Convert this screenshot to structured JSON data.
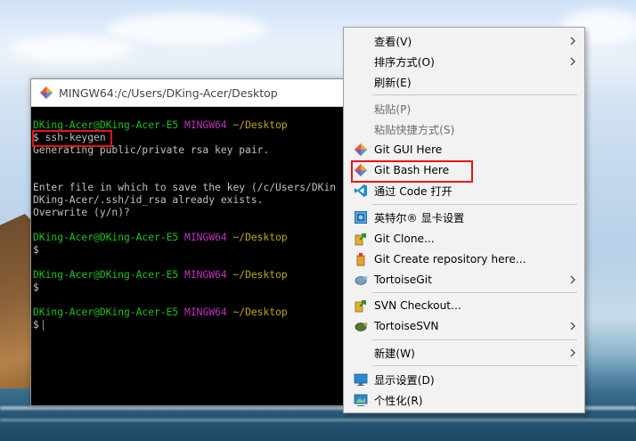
{
  "window": {
    "title": "MINGW64:/c/Users/DKing-Acer/Desktop"
  },
  "terminal": {
    "prompt_user": "DKing-Acer@DKing-Acer-E5",
    "prompt_env": "MINGW64",
    "prompt_path": "~/Desktop",
    "prompt_symbol": "$",
    "command": "ssh-keygen",
    "output": [
      "Generating public/private rsa key pair.",
      "Enter file in which to save the key (/c/Users/DKin",
      "DKing-Acer/.ssh/id_rsa already exists.",
      "Overwrite (y/n)?"
    ]
  },
  "context_menu": {
    "items": [
      {
        "label": "查看(V)",
        "icon": "",
        "submenu": true
      },
      {
        "label": "排序方式(O)",
        "icon": "",
        "submenu": true
      },
      {
        "label": "刷新(E)",
        "icon": ""
      },
      {
        "label": "粘贴(P)",
        "icon": "",
        "disabled": true
      },
      {
        "label": "粘贴快捷方式(S)",
        "icon": "",
        "disabled": true
      },
      {
        "label": "Git GUI Here",
        "icon": "git-diamond-icon"
      },
      {
        "label": "Git Bash Here",
        "icon": "git-diamond-icon",
        "highlighted": true
      },
      {
        "label": "通过 Code 打开",
        "icon": "vscode-icon"
      },
      {
        "label": "英特尔® 显卡设置",
        "icon": "intel-graphics-icon"
      },
      {
        "label": "Git Clone...",
        "icon": "tortoisegit-clone-icon"
      },
      {
        "label": "Git Create repository here...",
        "icon": "tortoisegit-create-repo-icon"
      },
      {
        "label": "TortoiseGit",
        "icon": "tortoisegit-icon",
        "submenu": true
      },
      {
        "label": "SVN Checkout...",
        "icon": "svn-checkout-icon"
      },
      {
        "label": "TortoiseSVN",
        "icon": "tortoisesvn-icon",
        "submenu": true
      },
      {
        "label": "新建(W)",
        "icon": "",
        "submenu": true
      },
      {
        "label": "显示设置(D)",
        "icon": "display-settings-icon"
      },
      {
        "label": "个性化(R)",
        "icon": "personalize-icon"
      }
    ]
  },
  "colors": {
    "highlight_box": "#e81414",
    "prompt_green": "#1cc31c",
    "prompt_magenta": "#c130c1",
    "prompt_yellow": "#c2a50b"
  }
}
